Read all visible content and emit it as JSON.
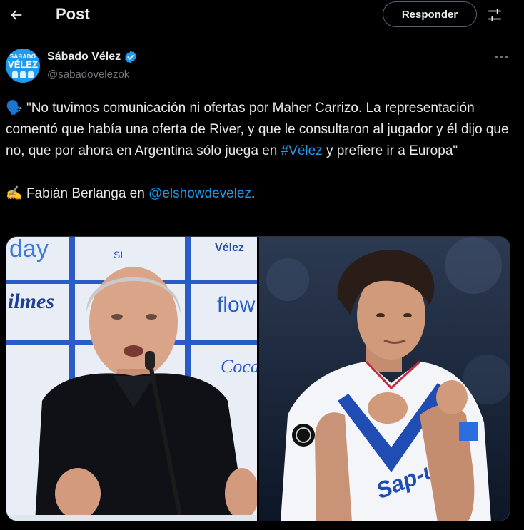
{
  "header": {
    "title": "Post",
    "respond_label": "Responder",
    "back_icon": "arrow-left-icon",
    "settings_icon": "sliders-icon"
  },
  "author": {
    "name": "Sábado Vélez",
    "handle": "@sabadovelezok",
    "avatar_text_top": "SÁBADO",
    "avatar_text_main": "VÉLEZ",
    "verified": true
  },
  "tweet": {
    "line1_emoji": "🗣️",
    "quote_part1": " \"No tuvimos comunicación ni ofertas por Maher Carrizo. La representación comentó que había una oferta de River, y que le consultaron al jugador y él dijo que no, que por ahora en Argentina sólo juega en ",
    "hashtag": "#Vélez",
    "quote_part2": " y prefiere ir a Europa\"",
    "line2_emoji": "✍️",
    "credit_text": " Fabián Berlanga en ",
    "mention": "@elshowdevelez",
    "credit_end": "."
  },
  "media": {
    "left_board_texts": [
      "day",
      "Vélez",
      "flow",
      "ilmes",
      "Coca-Co"
    ],
    "left_board_small": "SI",
    "right_jersey_text": "Sap-us"
  },
  "colors": {
    "background": "#000000",
    "text": "#e7e9ea",
    "muted": "#71767b",
    "link": "#1d9bf0",
    "verified": "#1d9bf0"
  }
}
